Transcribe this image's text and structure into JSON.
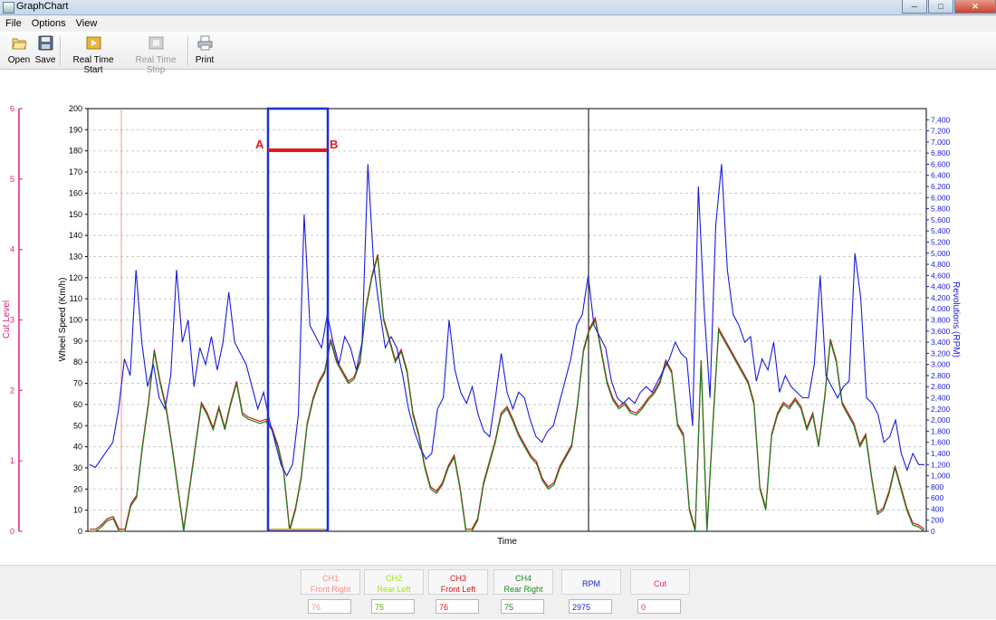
{
  "window": {
    "title": "GraphChart"
  },
  "menu": [
    "File",
    "Options",
    "View"
  ],
  "toolbar": {
    "open": "Open",
    "save": "Save",
    "real_time_start": "Real Time Start",
    "real_time_stop": "Real Time Stop",
    "print": "Print"
  },
  "chart": {
    "left_axis_label": "Cut Level",
    "left_axis_ticks": [
      "0",
      "1",
      "2",
      "3",
      "4",
      "5",
      "6"
    ],
    "speed_axis_label": "Wheel Speed (Km/h)",
    "speed_axis_ticks": [
      "0",
      "10",
      "20",
      "30",
      "40",
      "50",
      "60",
      "70",
      "80",
      "90",
      "100",
      "110",
      "120",
      "130",
      "140",
      "150",
      "160",
      "170",
      "180",
      "190",
      "200"
    ],
    "rpm_axis_label": "Revolutions (RPM)",
    "rpm_axis_ticks": [
      "0",
      "200",
      "400",
      "600",
      "800",
      "1,000",
      "1,200",
      "1,400",
      "1,600",
      "1,800",
      "2,000",
      "2,200",
      "2,400",
      "2,600",
      "2,800",
      "3,000",
      "3,200",
      "3,400",
      "3,600",
      "3,800",
      "4,000",
      "4,200",
      "4,400",
      "4,600",
      "4,800",
      "5,000",
      "5,200",
      "5,400",
      "5,600",
      "5,800",
      "6,000",
      "6,200",
      "6,400",
      "6,600",
      "6,800",
      "7,000",
      "7,200",
      "7,400"
    ],
    "x_axis_label": "Time",
    "marker_a": "A",
    "marker_b": "B",
    "colors": {
      "rpm": "#1a1adf",
      "speed": "#1e7d1e",
      "front_right": "#ff8888",
      "cut_axis": "#e0207f",
      "selection": "#1c2fd8",
      "marker": "#e21b1b"
    }
  },
  "chart_data": {
    "type": "line",
    "xlabel": "Time",
    "ylabel": "Wheel Speed (Km/h)",
    "ylim": [
      0,
      200
    ],
    "y2label": "Revolutions (RPM)",
    "y2lim": [
      0,
      7600
    ],
    "y3label": "Cut Level",
    "y3lim": [
      0,
      6
    ],
    "grid": true,
    "series": [
      {
        "name": "RPM",
        "axis": "right",
        "color": "#1a1adf",
        "values": [
          1200,
          1150,
          1300,
          1450,
          1600,
          2200,
          3100,
          2800,
          4700,
          3400,
          2600,
          3000,
          2400,
          2200,
          2800,
          4700,
          3400,
          3800,
          2600,
          3300,
          3000,
          3500,
          2900,
          3400,
          4300,
          3400,
          3200,
          3000,
          2600,
          2200,
          2500,
          2000,
          1600,
          1200,
          1000,
          1200,
          2100,
          5700,
          3700,
          3500,
          3300,
          3900,
          3400,
          3000,
          3500,
          3300,
          2900,
          3400,
          6600,
          4800,
          4000,
          3300,
          3500,
          3300,
          2800,
          2200,
          1800,
          1500,
          1300,
          1400,
          2200,
          2400,
          3800,
          2900,
          2500,
          2300,
          2600,
          2100,
          1800,
          1700,
          2400,
          3200,
          2500,
          2200,
          2500,
          2400,
          2000,
          1700,
          1600,
          1800,
          1900,
          2300,
          2700,
          3100,
          3700,
          3900,
          4600,
          3700,
          3500,
          3300,
          2700,
          2400,
          2300,
          2400,
          2300,
          2500,
          2600,
          2500,
          2700,
          2900,
          3100,
          3400,
          3200,
          3100,
          1900,
          6200,
          4000,
          2400,
          5500,
          6600,
          4700,
          3900,
          3700,
          3400,
          3500,
          2700,
          3100,
          2900,
          3400,
          2500,
          2800,
          2600,
          2500,
          2400,
          2400,
          3000,
          4600,
          2800,
          2600,
          2400,
          2600,
          2700,
          5000,
          4200,
          2400,
          2300,
          2100,
          1600,
          1700,
          2000,
          1400,
          1100,
          1400,
          1200,
          1200
        ]
      },
      {
        "name": "Wheel Speed",
        "axis": "left",
        "color": "#1e7d1e",
        "values": [
          0,
          0,
          2,
          5,
          6,
          0,
          0,
          12,
          16,
          40,
          60,
          85,
          70,
          58,
          40,
          20,
          0,
          20,
          40,
          60,
          55,
          48,
          58,
          48,
          60,
          70,
          55,
          53,
          52,
          51,
          52,
          48,
          40,
          28,
          0,
          10,
          25,
          50,
          62,
          70,
          75,
          90,
          80,
          75,
          70,
          72,
          80,
          105,
          120,
          130,
          100,
          90,
          80,
          85,
          75,
          55,
          45,
          30,
          20,
          18,
          22,
          30,
          35,
          20,
          0,
          0,
          5,
          22,
          32,
          42,
          55,
          58,
          52,
          45,
          40,
          35,
          32,
          24,
          20,
          22,
          30,
          35,
          40,
          60,
          85,
          95,
          100,
          85,
          70,
          62,
          58,
          60,
          56,
          55,
          58,
          62,
          65,
          70,
          80,
          75,
          50,
          45,
          10,
          0,
          80,
          0,
          50,
          95,
          90,
          85,
          80,
          75,
          70,
          60,
          20,
          10,
          45,
          55,
          60,
          58,
          62,
          58,
          48,
          55,
          40,
          62,
          90,
          80,
          60,
          55,
          50,
          40,
          45,
          25,
          8,
          10,
          18,
          30,
          20,
          10,
          3,
          2,
          0
        ]
      }
    ],
    "annotations": [
      "A",
      "B"
    ]
  },
  "bottom": {
    "channels": [
      {
        "code": "CH1",
        "name": "Front Right",
        "value": "76",
        "color": "#ff8c8c"
      },
      {
        "code": "CH2",
        "name": "Rear Left",
        "value": "75",
        "color": "#9be020"
      },
      {
        "code": "CH3",
        "name": "Front Left",
        "value": "76",
        "color": "#d61414"
      },
      {
        "code": "CH4",
        "name": "Rear Right",
        "value": "75",
        "color": "#1a8a1a"
      },
      {
        "code": "RPM",
        "name": "",
        "value": "2975",
        "color": "#1a1adf"
      },
      {
        "code": "Cut",
        "name": "",
        "value": "0",
        "color": "#e0207f"
      }
    ]
  }
}
